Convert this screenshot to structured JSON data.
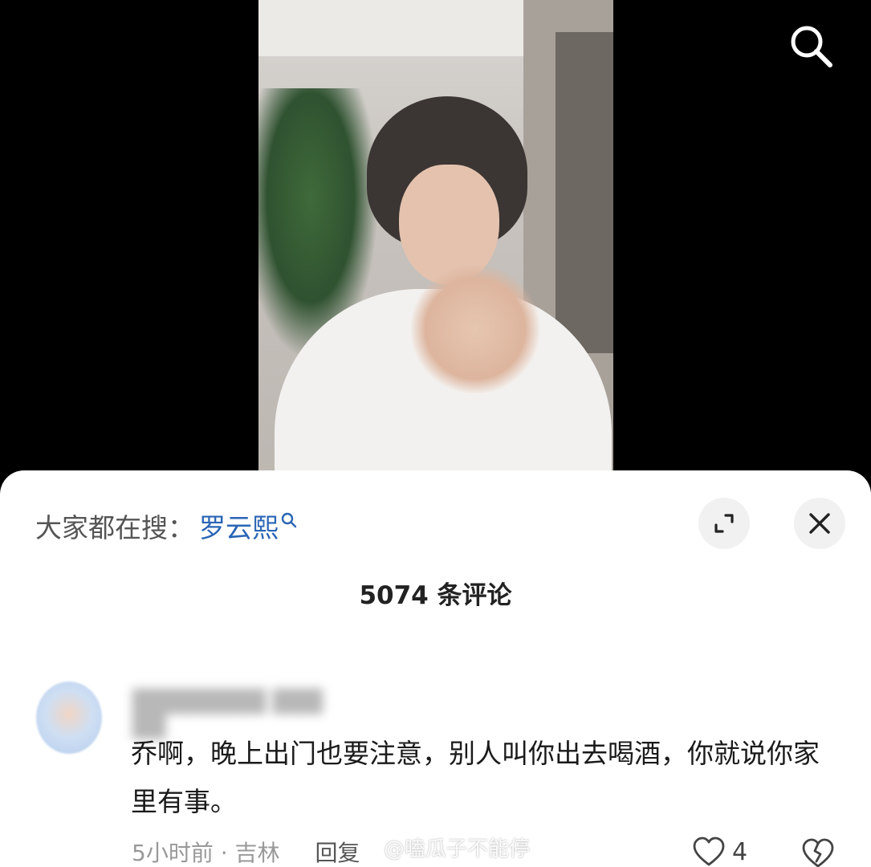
{
  "top_bar": {
    "search_icon": "search-icon"
  },
  "sheet": {
    "trending_label": "大家都在搜：",
    "trending_term": "罗云熙",
    "trending_icon": "small-search-icon",
    "expand_icon": "expand-icon",
    "close_icon": "close-icon",
    "comment_count": "5074 条评论"
  },
  "comment": {
    "text": "乔啊，晚上出门也要注意，别人叫你出去喝酒，你就说你家里有事。",
    "time_location": "5小时前 · 吉林",
    "reply_label": "回复",
    "like_icon": "heart-icon",
    "like_count": "4",
    "dislike_icon": "broken-heart-icon"
  },
  "watermark": "@嗑瓜子不能停",
  "colors": {
    "link_blue": "#2a65b5",
    "sheet_bg": "#ffffff",
    "page_bg": "#000000"
  }
}
